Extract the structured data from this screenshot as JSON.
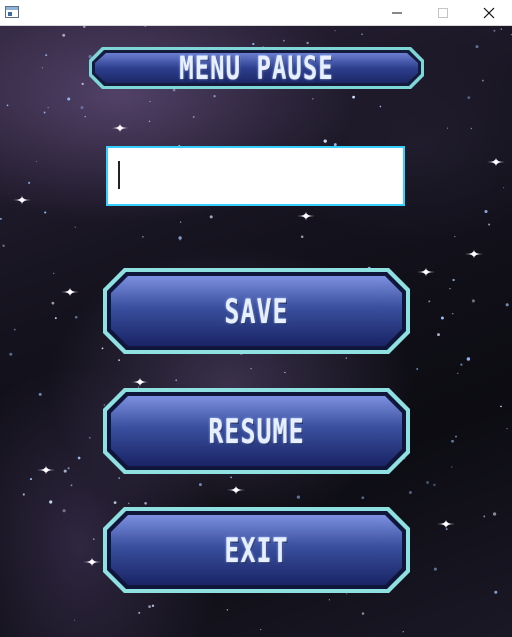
{
  "window": {
    "minimize_glyph": "─",
    "maximize_glyph": "☐",
    "close_glyph": "✕"
  },
  "menu": {
    "title": "MENU PAUSE",
    "input_value": "",
    "buttons": {
      "save": "SAVE",
      "resume": "RESUME",
      "exit": "EXIT"
    }
  },
  "colors": {
    "plate_fill": "#3a4f9e",
    "plate_border": "#7fd6d6",
    "input_border": "#35d0ff"
  },
  "icons": [
    "app-icon",
    "minimize-icon",
    "maximize-icon",
    "close-icon"
  ]
}
